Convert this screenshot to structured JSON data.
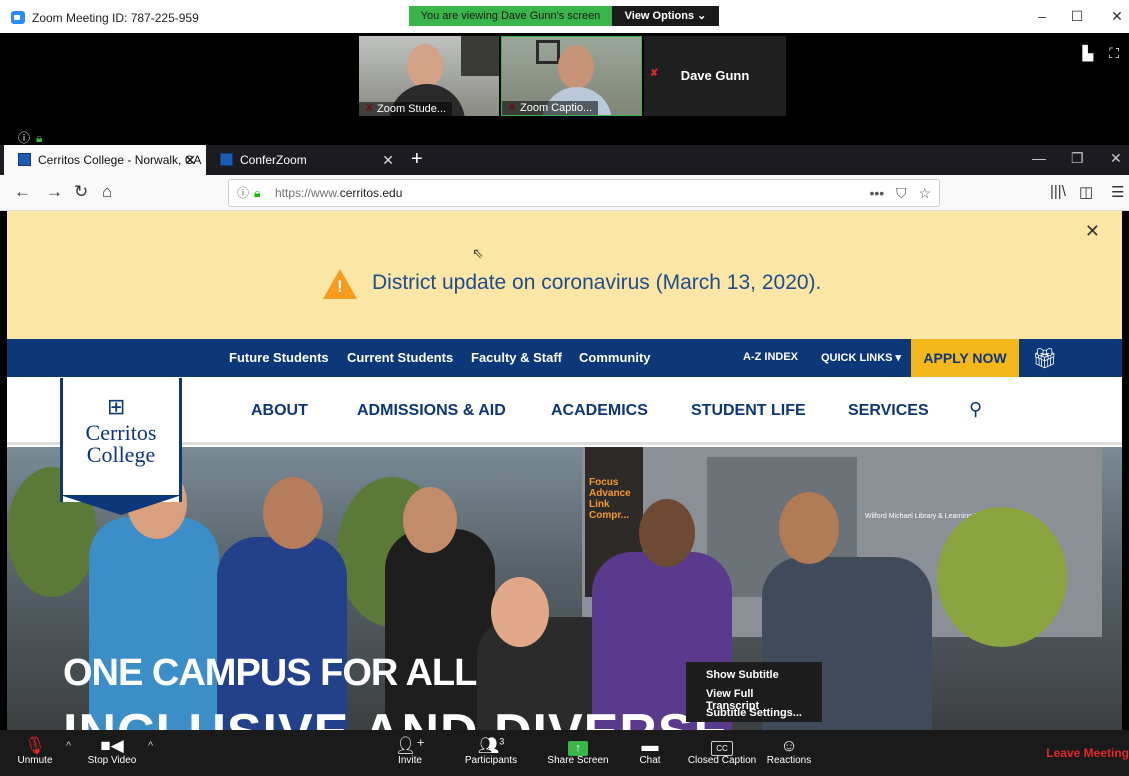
{
  "zoom_window": {
    "title": "Zoom Meeting ID: 787-225-959",
    "viewing_banner": "You are viewing Dave Gunn's screen",
    "view_options": "View Options ⌄",
    "controls": [
      "–",
      "☐",
      "✕"
    ]
  },
  "participants": [
    {
      "name": "Zoom Stude...",
      "muted": true
    },
    {
      "name": "Zoom Captio...",
      "muted": true
    },
    {
      "name": "Dave Gunn",
      "muted": true
    }
  ],
  "browser": {
    "tabs": [
      {
        "label": "Cerritos College - Norwalk, CA",
        "active": true
      },
      {
        "label": "ConferZoom",
        "active": false
      }
    ],
    "url_prefix": "https://www.",
    "url_domain": "cerritos.edu"
  },
  "site": {
    "alert_text": "District update on coronavirus (March 13, 2020).",
    "utility_nav": [
      "Future Students",
      "Current Students",
      "Faculty & Staff",
      "Community"
    ],
    "az_index": "A-Z INDEX",
    "quick_links": "QUICK LINKS ▾",
    "apply_now": "APPLY NOW",
    "main_nav": [
      "ABOUT",
      "ADMISSIONS & AID",
      "ACADEMICS",
      "STUDENT LIFE",
      "SERVICES"
    ],
    "logo_name_line1": "Cerritos",
    "logo_name_line2": "College",
    "hero_title": "ONE CAMPUS FOR ALL",
    "hero_subtitle": "INCLUSIVE AND DIVERSE",
    "library_sign": "Wilford Michael Library & Learning Resource Center",
    "focus_sign": "Focus Advance Link Compr..."
  },
  "context_menu": [
    "Show Subtitle",
    "View Full Transcript",
    "Subtitle Settings..."
  ],
  "zoom_toolbar": {
    "unmute": "Unmute",
    "stop_video": "Stop Video",
    "invite": "Invite",
    "participants": "Participants",
    "participant_count": "3",
    "share_screen": "Share Screen",
    "chat": "Chat",
    "closed_caption": "Closed Caption",
    "reactions": "Reactions",
    "leave": "Leave Meeting"
  },
  "colors": {
    "zoom_green": "#3ab54a",
    "cerritos_blue": "#0c3778",
    "apply_gold": "#f5b81c",
    "alert_bg": "#fbe6a6",
    "leave_red": "#e02828"
  }
}
